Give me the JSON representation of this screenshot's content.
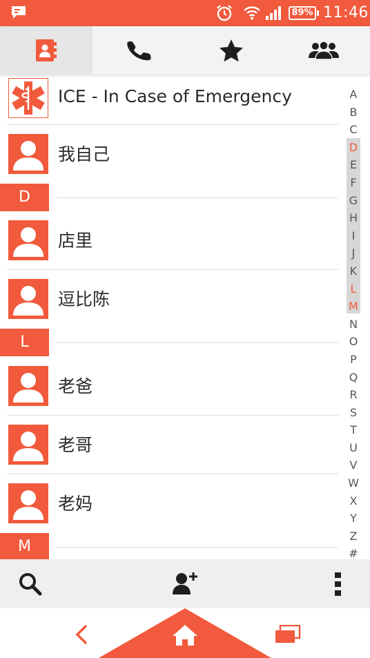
{
  "colors": {
    "accent": "#f15a3c",
    "tab_bg": "#f3f3f3",
    "tab_active_bg": "#e6e6e6",
    "index_highlight": "#d6d6d6"
  },
  "status_bar": {
    "battery": "89%",
    "time": "11:46",
    "icons": [
      "notification-icon",
      "alarm-icon",
      "wifi-icon",
      "signal-icon",
      "battery-icon"
    ]
  },
  "tabs": [
    {
      "id": "contacts",
      "icon": "contacts-book-icon",
      "active": true
    },
    {
      "id": "phone",
      "icon": "phone-icon",
      "active": false
    },
    {
      "id": "favorites",
      "icon": "star-icon",
      "active": false
    },
    {
      "id": "groups",
      "icon": "groups-icon",
      "active": false
    }
  ],
  "contacts": {
    "ice": {
      "name": "ICE - In Case of Emergency",
      "icon": "ice-medical-icon"
    },
    "me": {
      "name": "我自己"
    },
    "sections": [
      {
        "letter": "D",
        "entries": [
          {
            "name": "店里"
          },
          {
            "name": "逗比陈"
          }
        ]
      },
      {
        "letter": "L",
        "entries": [
          {
            "name": "老爸"
          },
          {
            "name": "老哥"
          },
          {
            "name": "老妈"
          }
        ]
      },
      {
        "letter": "M",
        "entries": []
      }
    ]
  },
  "index": {
    "letters": [
      "A",
      "B",
      "C",
      "D",
      "E",
      "F",
      "G",
      "H",
      "I",
      "J",
      "K",
      "L",
      "M",
      "N",
      "O",
      "P",
      "Q",
      "R",
      "S",
      "T",
      "U",
      "V",
      "W",
      "X",
      "Y",
      "Z",
      "#"
    ],
    "active_letters": [
      "D",
      "L",
      "M"
    ]
  },
  "action_bar": {
    "icons": [
      "search-icon",
      "add-contact-icon",
      "overflow-menu-icon"
    ]
  },
  "nav_bar": {
    "icons": [
      "back-icon",
      "home-icon",
      "recent-apps-icon"
    ]
  }
}
